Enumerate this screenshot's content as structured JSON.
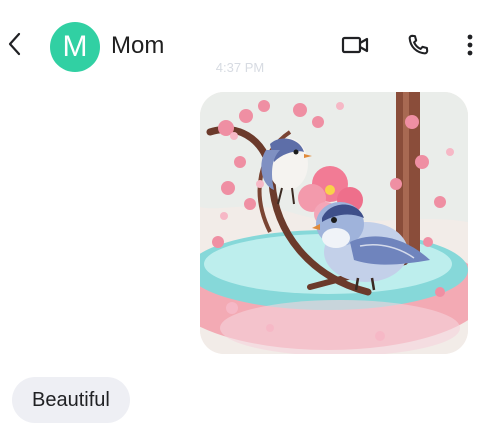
{
  "header": {
    "avatar_initial": "M",
    "contact_name": "Mom"
  },
  "conversation": {
    "timestamp": "4:37 PM",
    "messages": [
      {
        "direction": "outgoing",
        "type": "image",
        "icon": "bird-illustration-image"
      },
      {
        "direction": "incoming",
        "type": "text",
        "text": "Beautiful"
      }
    ]
  },
  "icons": [
    "back-arrow-icon",
    "video-call-icon",
    "phone-icon",
    "more-options-icon"
  ],
  "colors": {
    "avatar": "#31d0a3",
    "incoming_bubble": "#eeeff4",
    "text": "#1f1f1f"
  }
}
